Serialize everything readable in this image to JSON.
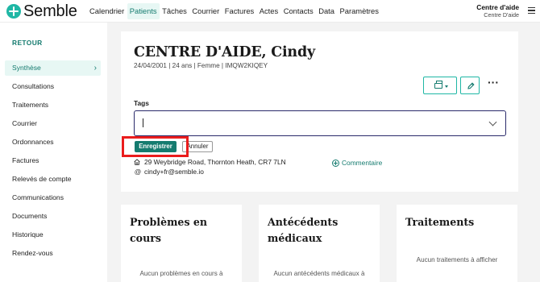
{
  "app": {
    "logo_text": "Semble"
  },
  "topnav": {
    "items": [
      {
        "label": "Calendrier",
        "active": false
      },
      {
        "label": "Patients",
        "active": true
      },
      {
        "label": "Tâches",
        "active": false
      },
      {
        "label": "Courrier",
        "active": false
      },
      {
        "label": "Factures",
        "active": false
      },
      {
        "label": "Actes",
        "active": false
      },
      {
        "label": "Contacts",
        "active": false
      },
      {
        "label": "Data",
        "active": false
      },
      {
        "label": "Paramètres",
        "active": false
      }
    ],
    "center_name": "Centre d'aide",
    "center_sub": "Centre D'aide"
  },
  "sidebar": {
    "back_label": "RETOUR",
    "items": [
      {
        "label": "Synthèse",
        "active": true
      },
      {
        "label": "Consultations",
        "active": false
      },
      {
        "label": "Traitements",
        "active": false
      },
      {
        "label": "Courrier",
        "active": false
      },
      {
        "label": "Ordonnances",
        "active": false
      },
      {
        "label": "Factures",
        "active": false
      },
      {
        "label": "Relevés de compte",
        "active": false
      },
      {
        "label": "Communications",
        "active": false
      },
      {
        "label": "Documents",
        "active": false
      },
      {
        "label": "Historique",
        "active": false
      },
      {
        "label": "Rendez-vous",
        "active": false
      }
    ],
    "active_chevron": "›"
  },
  "patient": {
    "name": "CENTRE D'AIDE, Cindy",
    "meta": "24/04/2001 | 24 ans | Femme | IMQW2KIQEY",
    "tags_label": "Tags",
    "tags_value": "",
    "save_label": "Enregistrer",
    "cancel_label": "Annuler",
    "address": "29 Weybridge Road, Thornton Heath, CR7 7LN",
    "email": "cindy+fr@semble.io",
    "comment_label": "Commentaire"
  },
  "cards": [
    {
      "title": "Problèmes en cours",
      "empty_text": "Aucun problèmes en cours à"
    },
    {
      "title": "Antécédents médicaux",
      "empty_text": "Aucun antécédents médicaux à"
    },
    {
      "title": "Traitements",
      "empty_text": "Aucun traitements à afficher"
    }
  ],
  "colors": {
    "accent": "#1fb7a5",
    "accent_dark": "#157b6f",
    "highlight": "#ea1d1d",
    "focus_border": "#2a2a6a"
  },
  "icons": [
    "menu-icon",
    "print-icon",
    "pencil-icon",
    "more-icon",
    "home-icon",
    "at-icon",
    "plus-circle-icon",
    "chevron-down-icon",
    "chevron-right-icon"
  ]
}
